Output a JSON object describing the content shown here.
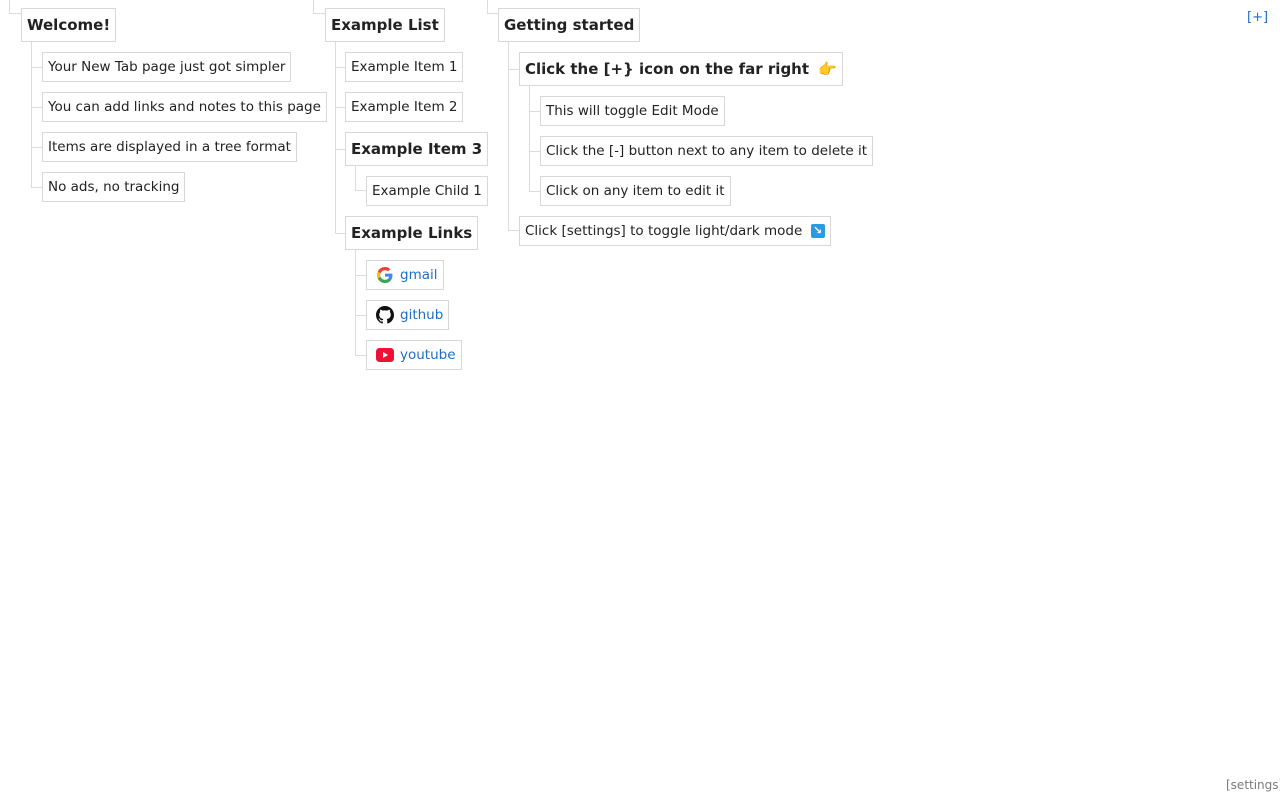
{
  "toolbar": {
    "edit_toggle": "[+]",
    "settings": "[settings]"
  },
  "columns": [
    {
      "title": "Welcome!",
      "items": [
        "Your New Tab page just got simpler",
        "You can add links and notes to this page",
        "Items are displayed in a tree format",
        "No ads, no tracking"
      ]
    },
    {
      "title": "Example List",
      "items": [
        "Example Item 1",
        "Example Item 2"
      ],
      "group": {
        "title": "Example Item 3",
        "children": [
          "Example Child 1"
        ]
      },
      "links": {
        "title": "Example Links",
        "items": [
          {
            "label": "gmail",
            "icon": "google-icon"
          },
          {
            "label": "github",
            "icon": "github-icon"
          },
          {
            "label": "youtube",
            "icon": "youtube-icon"
          }
        ]
      }
    },
    {
      "title": "Getting started",
      "group": {
        "title": "Click the [+} icon on the far right",
        "emoji": "👉",
        "children": [
          "This will toggle Edit Mode",
          "Click the [-] button next to any item to delete it",
          "Click on any item to edit it"
        ]
      },
      "items": [
        {
          "text": "Click [settings] to toggle light/dark mode",
          "emoji": "↘"
        }
      ]
    }
  ],
  "colors": {
    "link": "#1e6fc6",
    "border": "#d8d8d8",
    "text": "#222222",
    "muted": "#7a7a7a"
  }
}
